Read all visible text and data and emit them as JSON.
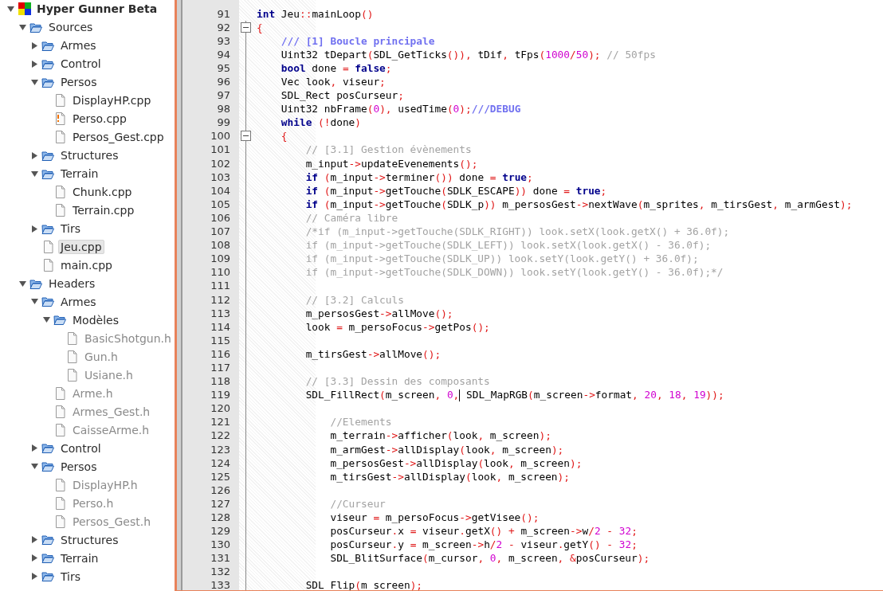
{
  "project_tree": [
    {
      "label": "Hyper Gunner Beta",
      "kind": "project",
      "expanded": true,
      "selected": false,
      "children": [
        {
          "label": "Sources",
          "kind": "folder",
          "expanded": true,
          "selected": false,
          "children": [
            {
              "label": "Armes",
              "kind": "folder",
              "expanded": false,
              "selected": false
            },
            {
              "label": "Control",
              "kind": "folder",
              "expanded": false,
              "selected": false
            },
            {
              "label": "Persos",
              "kind": "folder",
              "expanded": true,
              "selected": false,
              "children": [
                {
                  "label": "DisplayHP.cpp",
                  "kind": "file",
                  "selected": false,
                  "dimmed": false,
                  "modified": false
                },
                {
                  "label": "Perso.cpp",
                  "kind": "file",
                  "selected": false,
                  "dimmed": false,
                  "modified": true
                },
                {
                  "label": "Persos_Gest.cpp",
                  "kind": "file",
                  "selected": false,
                  "dimmed": false,
                  "modified": false
                }
              ]
            },
            {
              "label": "Structures",
              "kind": "folder",
              "expanded": false,
              "selected": false
            },
            {
              "label": "Terrain",
              "kind": "folder",
              "expanded": true,
              "selected": false,
              "children": [
                {
                  "label": "Chunk.cpp",
                  "kind": "file",
                  "selected": false,
                  "dimmed": false,
                  "modified": false
                },
                {
                  "label": "Terrain.cpp",
                  "kind": "file",
                  "selected": false,
                  "dimmed": false,
                  "modified": false
                }
              ]
            },
            {
              "label": "Tirs",
              "kind": "folder",
              "expanded": false,
              "selected": false
            },
            {
              "label": "Jeu.cpp",
              "kind": "file",
              "selected": true,
              "dimmed": false,
              "modified": false
            },
            {
              "label": "main.cpp",
              "kind": "file",
              "selected": false,
              "dimmed": false,
              "modified": false
            }
          ]
        },
        {
          "label": "Headers",
          "kind": "folder",
          "expanded": true,
          "selected": false,
          "children": [
            {
              "label": "Armes",
              "kind": "folder",
              "expanded": true,
              "selected": false,
              "children": [
                {
                  "label": "Modèles",
                  "kind": "folder",
                  "expanded": true,
                  "selected": false,
                  "children": [
                    {
                      "label": "BasicShotgun.h",
                      "kind": "file",
                      "selected": false,
                      "dimmed": true,
                      "modified": false
                    },
                    {
                      "label": "Gun.h",
                      "kind": "file",
                      "selected": false,
                      "dimmed": true,
                      "modified": false
                    },
                    {
                      "label": "Usiane.h",
                      "kind": "file",
                      "selected": false,
                      "dimmed": true,
                      "modified": false
                    }
                  ]
                },
                {
                  "label": "Arme.h",
                  "kind": "file",
                  "selected": false,
                  "dimmed": true,
                  "modified": false
                },
                {
                  "label": "Armes_Gest.h",
                  "kind": "file",
                  "selected": false,
                  "dimmed": true,
                  "modified": false
                },
                {
                  "label": "CaisseArme.h",
                  "kind": "file",
                  "selected": false,
                  "dimmed": true,
                  "modified": false
                }
              ]
            },
            {
              "label": "Control",
              "kind": "folder",
              "expanded": false,
              "selected": false
            },
            {
              "label": "Persos",
              "kind": "folder",
              "expanded": true,
              "selected": false,
              "children": [
                {
                  "label": "DisplayHP.h",
                  "kind": "file",
                  "selected": false,
                  "dimmed": true,
                  "modified": false
                },
                {
                  "label": "Perso.h",
                  "kind": "file",
                  "selected": false,
                  "dimmed": true,
                  "modified": false
                },
                {
                  "label": "Persos_Gest.h",
                  "kind": "file",
                  "selected": false,
                  "dimmed": true,
                  "modified": false
                }
              ]
            },
            {
              "label": "Structures",
              "kind": "folder",
              "expanded": false,
              "selected": false
            },
            {
              "label": "Terrain",
              "kind": "folder",
              "expanded": false,
              "selected": false
            },
            {
              "label": "Tirs",
              "kind": "folder",
              "expanded": false,
              "selected": false
            }
          ]
        }
      ]
    }
  ],
  "editor": {
    "lines": [
      {
        "number": "91",
        "fold_start": false,
        "tokens": [
          {
            "kind": "keyword",
            "text": "int"
          },
          {
            "kind": "plain",
            "text": " Jeu"
          },
          {
            "kind": "operator",
            "text": "::"
          },
          {
            "kind": "plain",
            "text": "mainLoop"
          },
          {
            "kind": "operator",
            "text": "()"
          }
        ]
      },
      {
        "number": "92",
        "fold_start": true,
        "tokens": [
          {
            "kind": "operator",
            "text": "{"
          }
        ]
      },
      {
        "number": "93",
        "fold_start": false,
        "tokens": [
          {
            "kind": "doc",
            "text": "    /// [1] Boucle principale"
          }
        ]
      },
      {
        "number": "94",
        "fold_start": false,
        "tokens": [
          {
            "kind": "plain",
            "text": "    Uint32 tDepart"
          },
          {
            "kind": "operator",
            "text": "("
          },
          {
            "kind": "plain",
            "text": "SDL_GetTicks"
          },
          {
            "kind": "operator",
            "text": "()), "
          },
          {
            "kind": "plain",
            "text": "tDif"
          },
          {
            "kind": "operator",
            "text": ", "
          },
          {
            "kind": "plain",
            "text": "tFps"
          },
          {
            "kind": "operator",
            "text": "("
          },
          {
            "kind": "number",
            "text": "1000"
          },
          {
            "kind": "operator",
            "text": "/"
          },
          {
            "kind": "number",
            "text": "50"
          },
          {
            "kind": "operator",
            "text": "); "
          },
          {
            "kind": "comment",
            "text": "// 50fps"
          }
        ]
      },
      {
        "number": "95",
        "fold_start": false,
        "tokens": [
          {
            "kind": "keyword",
            "text": "    bool"
          },
          {
            "kind": "plain",
            "text": " done "
          },
          {
            "kind": "operator",
            "text": "= "
          },
          {
            "kind": "keyword",
            "text": "false"
          },
          {
            "kind": "operator",
            "text": ";"
          }
        ]
      },
      {
        "number": "96",
        "fold_start": false,
        "tokens": [
          {
            "kind": "plain",
            "text": "    Vec look"
          },
          {
            "kind": "operator",
            "text": ", "
          },
          {
            "kind": "plain",
            "text": "viseur"
          },
          {
            "kind": "operator",
            "text": ";"
          }
        ]
      },
      {
        "number": "97",
        "fold_start": false,
        "tokens": [
          {
            "kind": "plain",
            "text": "    SDL_Rect posCurseur"
          },
          {
            "kind": "operator",
            "text": ";"
          }
        ]
      },
      {
        "number": "98",
        "fold_start": false,
        "tokens": [
          {
            "kind": "plain",
            "text": "    Uint32 nbFrame"
          },
          {
            "kind": "operator",
            "text": "("
          },
          {
            "kind": "number",
            "text": "0"
          },
          {
            "kind": "operator",
            "text": "), "
          },
          {
            "kind": "plain",
            "text": "usedTime"
          },
          {
            "kind": "operator",
            "text": "("
          },
          {
            "kind": "number",
            "text": "0"
          },
          {
            "kind": "operator",
            "text": ");"
          },
          {
            "kind": "doc",
            "text": "///DEBUG"
          }
        ]
      },
      {
        "number": "99",
        "fold_start": false,
        "tokens": [
          {
            "kind": "keyword",
            "text": "    while"
          },
          {
            "kind": "operator",
            "text": " (!"
          },
          {
            "kind": "plain",
            "text": "done"
          },
          {
            "kind": "operator",
            "text": ")"
          }
        ]
      },
      {
        "number": "100",
        "fold_start": true,
        "tokens": [
          {
            "kind": "operator",
            "text": "    {"
          }
        ]
      },
      {
        "number": "101",
        "fold_start": false,
        "tokens": [
          {
            "kind": "comment",
            "text": "        // [3.1] Gestion évènements"
          }
        ]
      },
      {
        "number": "102",
        "fold_start": false,
        "tokens": [
          {
            "kind": "plain",
            "text": "        m_input"
          },
          {
            "kind": "operator",
            "text": "->"
          },
          {
            "kind": "plain",
            "text": "updateEvenements"
          },
          {
            "kind": "operator",
            "text": "();"
          }
        ]
      },
      {
        "number": "103",
        "fold_start": false,
        "tokens": [
          {
            "kind": "keyword",
            "text": "        if"
          },
          {
            "kind": "operator",
            "text": " ("
          },
          {
            "kind": "plain",
            "text": "m_input"
          },
          {
            "kind": "operator",
            "text": "->"
          },
          {
            "kind": "plain",
            "text": "terminer"
          },
          {
            "kind": "operator",
            "text": "()) "
          },
          {
            "kind": "plain",
            "text": "done "
          },
          {
            "kind": "operator",
            "text": "= "
          },
          {
            "kind": "keyword",
            "text": "true"
          },
          {
            "kind": "operator",
            "text": ";"
          }
        ]
      },
      {
        "number": "104",
        "fold_start": false,
        "tokens": [
          {
            "kind": "keyword",
            "text": "        if"
          },
          {
            "kind": "operator",
            "text": " ("
          },
          {
            "kind": "plain",
            "text": "m_input"
          },
          {
            "kind": "operator",
            "text": "->"
          },
          {
            "kind": "plain",
            "text": "getTouche"
          },
          {
            "kind": "operator",
            "text": "("
          },
          {
            "kind": "plain",
            "text": "SDLK_ESCAPE"
          },
          {
            "kind": "operator",
            "text": ")) "
          },
          {
            "kind": "plain",
            "text": "done "
          },
          {
            "kind": "operator",
            "text": "= "
          },
          {
            "kind": "keyword",
            "text": "true"
          },
          {
            "kind": "operator",
            "text": ";"
          }
        ]
      },
      {
        "number": "105",
        "fold_start": false,
        "tokens": [
          {
            "kind": "keyword",
            "text": "        if"
          },
          {
            "kind": "operator",
            "text": " ("
          },
          {
            "kind": "plain",
            "text": "m_input"
          },
          {
            "kind": "operator",
            "text": "->"
          },
          {
            "kind": "plain",
            "text": "getTouche"
          },
          {
            "kind": "operator",
            "text": "("
          },
          {
            "kind": "plain",
            "text": "SDLK_p"
          },
          {
            "kind": "operator",
            "text": ")) "
          },
          {
            "kind": "plain",
            "text": "m_persosGest"
          },
          {
            "kind": "operator",
            "text": "->"
          },
          {
            "kind": "plain",
            "text": "nextWave"
          },
          {
            "kind": "operator",
            "text": "("
          },
          {
            "kind": "plain",
            "text": "m_sprites"
          },
          {
            "kind": "operator",
            "text": ", "
          },
          {
            "kind": "plain",
            "text": "m_tirsGest"
          },
          {
            "kind": "operator",
            "text": ", "
          },
          {
            "kind": "plain",
            "text": "m_armGest"
          },
          {
            "kind": "operator",
            "text": ");"
          }
        ]
      },
      {
        "number": "106",
        "fold_start": false,
        "tokens": [
          {
            "kind": "comment",
            "text": "        // Caméra libre"
          }
        ]
      },
      {
        "number": "107",
        "fold_start": false,
        "tokens": [
          {
            "kind": "comment",
            "text": "        /*if (m_input->getTouche(SDLK_RIGHT)) look.setX(look.getX() + 36.0f);"
          }
        ]
      },
      {
        "number": "108",
        "fold_start": false,
        "tokens": [
          {
            "kind": "comment",
            "text": "        if (m_input->getTouche(SDLK_LEFT)) look.setX(look.getX() - 36.0f);"
          }
        ]
      },
      {
        "number": "109",
        "fold_start": false,
        "tokens": [
          {
            "kind": "comment",
            "text": "        if (m_input->getTouche(SDLK_UP)) look.setY(look.getY() + 36.0f);"
          }
        ]
      },
      {
        "number": "110",
        "fold_start": false,
        "tokens": [
          {
            "kind": "comment",
            "text": "        if (m_input->getTouche(SDLK_DOWN)) look.setY(look.getY() - 36.0f);*/"
          }
        ]
      },
      {
        "number": "111",
        "fold_start": false
      },
      {
        "number": "112",
        "fold_start": false,
        "tokens": [
          {
            "kind": "comment",
            "text": "        // [3.2] Calculs"
          }
        ]
      },
      {
        "number": "113",
        "fold_start": false,
        "tokens": [
          {
            "kind": "plain",
            "text": "        m_persosGest"
          },
          {
            "kind": "operator",
            "text": "->"
          },
          {
            "kind": "plain",
            "text": "allMove"
          },
          {
            "kind": "operator",
            "text": "();"
          }
        ]
      },
      {
        "number": "114",
        "fold_start": false,
        "tokens": [
          {
            "kind": "plain",
            "text": "        look "
          },
          {
            "kind": "operator",
            "text": "= "
          },
          {
            "kind": "plain",
            "text": "m_persoFocus"
          },
          {
            "kind": "operator",
            "text": "->"
          },
          {
            "kind": "plain",
            "text": "getPos"
          },
          {
            "kind": "operator",
            "text": "();"
          }
        ]
      },
      {
        "number": "115",
        "fold_start": false
      },
      {
        "number": "116",
        "fold_start": false,
        "tokens": [
          {
            "kind": "plain",
            "text": "        m_tirsGest"
          },
          {
            "kind": "operator",
            "text": "->"
          },
          {
            "kind": "plain",
            "text": "allMove"
          },
          {
            "kind": "operator",
            "text": "();"
          }
        ]
      },
      {
        "number": "117",
        "fold_start": false
      },
      {
        "number": "118",
        "fold_start": false,
        "tokens": [
          {
            "kind": "comment",
            "text": "        // [3.3] Dessin des composants"
          }
        ]
      },
      {
        "number": "119",
        "fold_start": false,
        "tokens": [
          {
            "kind": "plain",
            "text": "        SDL_FillRect"
          },
          {
            "kind": "operator",
            "text": "("
          },
          {
            "kind": "plain",
            "text": "m_screen"
          },
          {
            "kind": "operator",
            "text": ", "
          },
          {
            "kind": "number",
            "text": "0"
          },
          {
            "kind": "operator",
            "text": ","
          },
          {
            "kind": "caret"
          },
          {
            "kind": "plain",
            "text": " SDL_MapRGB"
          },
          {
            "kind": "operator",
            "text": "("
          },
          {
            "kind": "plain",
            "text": "m_screen"
          },
          {
            "kind": "operator",
            "text": "->"
          },
          {
            "kind": "plain",
            "text": "format"
          },
          {
            "kind": "operator",
            "text": ", "
          },
          {
            "kind": "number",
            "text": "20"
          },
          {
            "kind": "operator",
            "text": ", "
          },
          {
            "kind": "number",
            "text": "18"
          },
          {
            "kind": "operator",
            "text": ", "
          },
          {
            "kind": "number",
            "text": "19"
          },
          {
            "kind": "operator",
            "text": "));"
          }
        ]
      },
      {
        "number": "120",
        "fold_start": false
      },
      {
        "number": "121",
        "fold_start": false,
        "tokens": [
          {
            "kind": "comment",
            "text": "            //Elements"
          }
        ]
      },
      {
        "number": "122",
        "fold_start": false,
        "tokens": [
          {
            "kind": "plain",
            "text": "            m_terrain"
          },
          {
            "kind": "operator",
            "text": "->"
          },
          {
            "kind": "plain",
            "text": "afficher"
          },
          {
            "kind": "operator",
            "text": "("
          },
          {
            "kind": "plain",
            "text": "look"
          },
          {
            "kind": "operator",
            "text": ", "
          },
          {
            "kind": "plain",
            "text": "m_screen"
          },
          {
            "kind": "operator",
            "text": ");"
          }
        ]
      },
      {
        "number": "123",
        "fold_start": false,
        "tokens": [
          {
            "kind": "plain",
            "text": "            m_armGest"
          },
          {
            "kind": "operator",
            "text": "->"
          },
          {
            "kind": "plain",
            "text": "allDisplay"
          },
          {
            "kind": "operator",
            "text": "("
          },
          {
            "kind": "plain",
            "text": "look"
          },
          {
            "kind": "operator",
            "text": ", "
          },
          {
            "kind": "plain",
            "text": "m_screen"
          },
          {
            "kind": "operator",
            "text": ");"
          }
        ]
      },
      {
        "number": "124",
        "fold_start": false,
        "tokens": [
          {
            "kind": "plain",
            "text": "            m_persosGest"
          },
          {
            "kind": "operator",
            "text": "->"
          },
          {
            "kind": "plain",
            "text": "allDisplay"
          },
          {
            "kind": "operator",
            "text": "("
          },
          {
            "kind": "plain",
            "text": "look"
          },
          {
            "kind": "operator",
            "text": ", "
          },
          {
            "kind": "plain",
            "text": "m_screen"
          },
          {
            "kind": "operator",
            "text": ");"
          }
        ]
      },
      {
        "number": "125",
        "fold_start": false,
        "tokens": [
          {
            "kind": "plain",
            "text": "            m_tirsGest"
          },
          {
            "kind": "operator",
            "text": "->"
          },
          {
            "kind": "plain",
            "text": "allDisplay"
          },
          {
            "kind": "operator",
            "text": "("
          },
          {
            "kind": "plain",
            "text": "look"
          },
          {
            "kind": "operator",
            "text": ", "
          },
          {
            "kind": "plain",
            "text": "m_screen"
          },
          {
            "kind": "operator",
            "text": ");"
          }
        ]
      },
      {
        "number": "126",
        "fold_start": false
      },
      {
        "number": "127",
        "fold_start": false,
        "tokens": [
          {
            "kind": "comment",
            "text": "            //Curseur"
          }
        ]
      },
      {
        "number": "128",
        "fold_start": false,
        "tokens": [
          {
            "kind": "plain",
            "text": "            viseur "
          },
          {
            "kind": "operator",
            "text": "= "
          },
          {
            "kind": "plain",
            "text": "m_persoFocus"
          },
          {
            "kind": "operator",
            "text": "->"
          },
          {
            "kind": "plain",
            "text": "getVisee"
          },
          {
            "kind": "operator",
            "text": "();"
          }
        ]
      },
      {
        "number": "129",
        "fold_start": false,
        "tokens": [
          {
            "kind": "plain",
            "text": "            posCurseur"
          },
          {
            "kind": "operator",
            "text": "."
          },
          {
            "kind": "plain",
            "text": "x "
          },
          {
            "kind": "operator",
            "text": "= "
          },
          {
            "kind": "plain",
            "text": "viseur"
          },
          {
            "kind": "operator",
            "text": "."
          },
          {
            "kind": "plain",
            "text": "getX"
          },
          {
            "kind": "operator",
            "text": "() + "
          },
          {
            "kind": "plain",
            "text": "m_screen"
          },
          {
            "kind": "operator",
            "text": "->"
          },
          {
            "kind": "plain",
            "text": "w"
          },
          {
            "kind": "operator",
            "text": "/"
          },
          {
            "kind": "number",
            "text": "2"
          },
          {
            "kind": "operator",
            "text": " - "
          },
          {
            "kind": "number",
            "text": "32"
          },
          {
            "kind": "operator",
            "text": ";"
          }
        ]
      },
      {
        "number": "130",
        "fold_start": false,
        "tokens": [
          {
            "kind": "plain",
            "text": "            posCurseur"
          },
          {
            "kind": "operator",
            "text": "."
          },
          {
            "kind": "plain",
            "text": "y "
          },
          {
            "kind": "operator",
            "text": "= "
          },
          {
            "kind": "plain",
            "text": "m_screen"
          },
          {
            "kind": "operator",
            "text": "->"
          },
          {
            "kind": "plain",
            "text": "h"
          },
          {
            "kind": "operator",
            "text": "/"
          },
          {
            "kind": "number",
            "text": "2"
          },
          {
            "kind": "operator",
            "text": " - "
          },
          {
            "kind": "plain",
            "text": "viseur"
          },
          {
            "kind": "operator",
            "text": "."
          },
          {
            "kind": "plain",
            "text": "getY"
          },
          {
            "kind": "operator",
            "text": "() - "
          },
          {
            "kind": "number",
            "text": "32"
          },
          {
            "kind": "operator",
            "text": ";"
          }
        ]
      },
      {
        "number": "131",
        "fold_start": false,
        "tokens": [
          {
            "kind": "plain",
            "text": "            SDL_BlitSurface"
          },
          {
            "kind": "operator",
            "text": "("
          },
          {
            "kind": "plain",
            "text": "m_cursor"
          },
          {
            "kind": "operator",
            "text": ", "
          },
          {
            "kind": "number",
            "text": "0"
          },
          {
            "kind": "operator",
            "text": ", "
          },
          {
            "kind": "plain",
            "text": "m_screen"
          },
          {
            "kind": "operator",
            "text": ", &"
          },
          {
            "kind": "plain",
            "text": "posCurseur"
          },
          {
            "kind": "operator",
            "text": ");"
          }
        ]
      },
      {
        "number": "132",
        "fold_start": false
      },
      {
        "number": "133",
        "fold_start": false,
        "tokens": [
          {
            "kind": "plain",
            "text": "        SDL_Flip"
          },
          {
            "kind": "operator",
            "text": "("
          },
          {
            "kind": "plain",
            "text": "m_screen"
          },
          {
            "kind": "operator",
            "text": ");"
          }
        ]
      }
    ]
  }
}
